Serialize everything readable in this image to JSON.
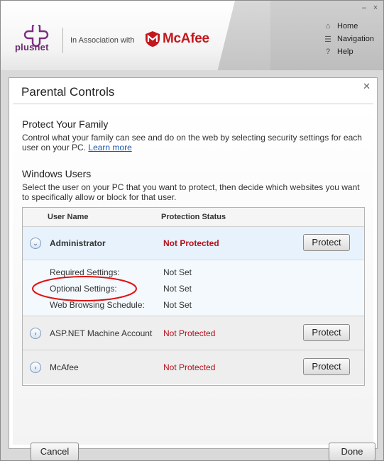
{
  "header": {
    "brand": "plusnet",
    "association": "In Association with",
    "partner": "McAfee",
    "nav": [
      {
        "label": "Home",
        "icon": "home-icon"
      },
      {
        "label": "Navigation",
        "icon": "list-icon"
      },
      {
        "label": "Help",
        "icon": "help-icon"
      }
    ]
  },
  "dialog": {
    "title": "Parental Controls",
    "section1": {
      "heading": "Protect Your Family",
      "text": "Control what your family can see and do on the web by selecting security settings for each user on your PC.",
      "link": "Learn more"
    },
    "section2": {
      "heading": "Windows Users",
      "text": "Select the user on your PC that you want to protect, then decide which websites you want to specifically allow or block for that user."
    },
    "table": {
      "col_user": "User Name",
      "col_status": "Protection Status",
      "users": [
        {
          "name": "Administrator",
          "status": "Not Protected",
          "action": "Protect",
          "expanded": true
        },
        {
          "name": "ASP.NET Machine Account",
          "status": "Not Protected",
          "action": "Protect",
          "expanded": false
        },
        {
          "name": "McAfee",
          "status": "Not Protected",
          "action": "Protect",
          "expanded": false
        }
      ],
      "details": [
        {
          "label": "Required Settings:",
          "value": "Not Set"
        },
        {
          "label": "Optional Settings:",
          "value": "Not Set"
        },
        {
          "label": "Web Browsing Schedule:",
          "value": "Not Set"
        }
      ]
    },
    "buttons": {
      "cancel": "Cancel",
      "done": "Done"
    }
  },
  "colors": {
    "status_red": "#b3111c",
    "brand_purple": "#6b2a6f",
    "mcafee_red": "#c4161c"
  }
}
